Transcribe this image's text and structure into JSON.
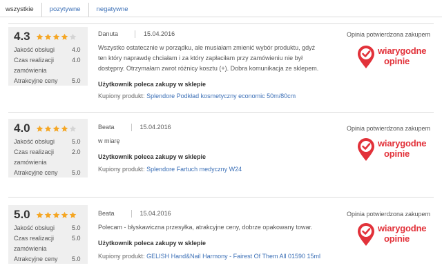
{
  "tabs": [
    {
      "label": "wszystkie",
      "active": true
    },
    {
      "label": "pozytywne",
      "active": false
    },
    {
      "label": "negatywne",
      "active": false
    }
  ],
  "colors": {
    "star": "#f5a623",
    "star_empty": "#d4d4d4",
    "badge_red": "#e2323a",
    "link": "#3b6fb6"
  },
  "reviews": [
    {
      "score": "4.3",
      "stars_filled": 4,
      "ratings": [
        {
          "label": "Jakość obsługi",
          "value": "4.0"
        },
        {
          "label": "Czas realizacji zamówienia",
          "value": "4.0"
        },
        {
          "label": "Atrakcyjne ceny",
          "value": "5.0"
        }
      ],
      "author": "Danuta",
      "date": "15.04.2016",
      "text": "Wszystko ostatecznie w porządku, ale musiałam zmienić wybór produktu, gdyż ten który naprawdę chciałam i za który zapłaciłam przy zamówieniu nie był dostępny. Otrzymałam zwrot różnicy kosztu (+). Dobra komunikacja ze sklepem.",
      "recommend": "Użytkownik poleca zakupy w sklepie",
      "product_label": "Kupiony produkt:",
      "product_name": "Splendore Podkład kosmetyczny economic 50m/80cm",
      "verified": "Opinia potwierdzona zakupem",
      "badge_line1": "wiarygodne",
      "badge_line2": "opinie",
      "badge_icon": "check-pin-icon"
    },
    {
      "score": "4.0",
      "stars_filled": 4,
      "ratings": [
        {
          "label": "Jakość obsługi",
          "value": "5.0"
        },
        {
          "label": "Czas realizacji zamówienia",
          "value": "2.0"
        },
        {
          "label": "Atrakcyjne ceny",
          "value": "5.0"
        }
      ],
      "author": "Beata",
      "date": "15.04.2016",
      "text": "w miarę",
      "recommend": "Użytkownik poleca zakupy w sklepie",
      "product_label": "Kupiony produkt:",
      "product_name": "Splendore Fartuch medyczny W24",
      "verified": "Opinia potwierdzona zakupem",
      "badge_line1": "wiarygodne",
      "badge_line2": "opinie",
      "badge_icon": "check-pin-icon"
    },
    {
      "score": "5.0",
      "stars_filled": 5,
      "ratings": [
        {
          "label": "Jakość obsługi",
          "value": "5.0"
        },
        {
          "label": "Czas realizacji zamówienia",
          "value": "5.0"
        },
        {
          "label": "Atrakcyjne ceny",
          "value": "5.0"
        }
      ],
      "author": "Beata",
      "date": "15.04.2016",
      "text": "Polecam - błyskawiczna przesyłka, atrakcyjne ceny, dobrze opakowany towar.",
      "recommend": "Użytkownik poleca zakupy w sklepie",
      "product_label": "Kupiony produkt:",
      "product_name": "GELISH Hand&Nail Harmony - Fairest Of Them All 01590 15ml",
      "verified": "Opinia potwierdzona zakupem",
      "badge_line1": "wiarygodne",
      "badge_line2": "opinie",
      "badge_icon": "check-pin-icon"
    }
  ]
}
